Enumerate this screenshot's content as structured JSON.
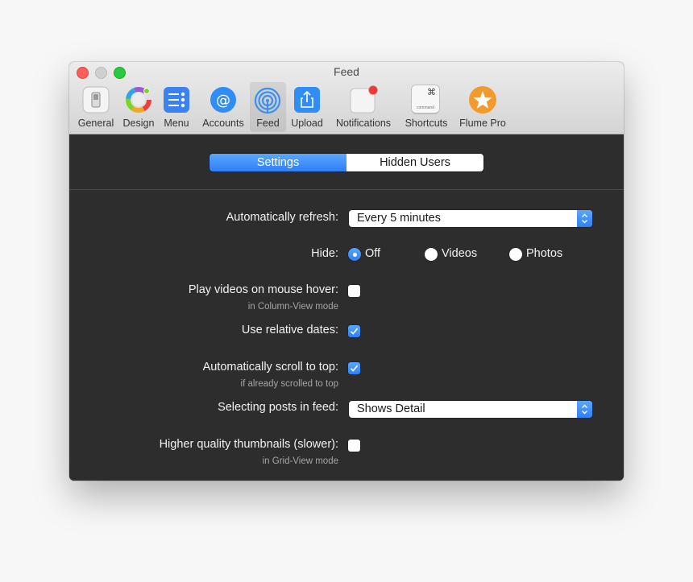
{
  "window": {
    "title": "Feed"
  },
  "toolbar": {
    "items": [
      {
        "label": "General",
        "icon": "switch-icon"
      },
      {
        "label": "Design",
        "icon": "color-wheel-icon"
      },
      {
        "label": "Menu",
        "icon": "menu-list-icon"
      },
      {
        "label": "Accounts",
        "icon": "at-sign-icon"
      },
      {
        "label": "Feed",
        "icon": "feed-broadcast-icon",
        "selected": true
      },
      {
        "label": "Upload",
        "icon": "upload-share-icon"
      },
      {
        "label": "Notifications",
        "icon": "notification-badge-icon"
      },
      {
        "label": "Shortcuts",
        "icon": "command-key-icon",
        "key_glyph": "⌘",
        "key_text": "command"
      },
      {
        "label": "Flume Pro",
        "icon": "star-icon"
      }
    ]
  },
  "tabs": [
    {
      "label": "Settings",
      "selected": true
    },
    {
      "label": "Hidden Users",
      "selected": false
    }
  ],
  "settings": {
    "refresh": {
      "label": "Automatically refresh:",
      "value": "Every 5 minutes"
    },
    "hide": {
      "label": "Hide:",
      "options": [
        {
          "label": "Off",
          "selected": true
        },
        {
          "label": "Videos",
          "selected": false
        },
        {
          "label": "Photos",
          "selected": false
        }
      ]
    },
    "play_videos": {
      "label": "Play videos on mouse hover:",
      "sublabel": "in Column-View mode",
      "checked": false
    },
    "relative_dates": {
      "label": "Use relative dates:",
      "checked": true
    },
    "scroll_top": {
      "label": "Automatically scroll to top:",
      "sublabel": "if already scrolled to top",
      "checked": true
    },
    "selecting_posts": {
      "label": "Selecting posts in feed:",
      "value": "Shows Detail"
    },
    "hq_thumbnails": {
      "label": "Higher quality thumbnails (slower):",
      "sublabel": "in Grid-View mode",
      "checked": false
    }
  },
  "colors": {
    "accent": "#2f7ff5",
    "panel_background": "#2d2d2d",
    "titlebar": "#e2e2e2",
    "close": "#fc5f57",
    "minimize": "#d0d0d0",
    "maximize": "#29c940"
  }
}
